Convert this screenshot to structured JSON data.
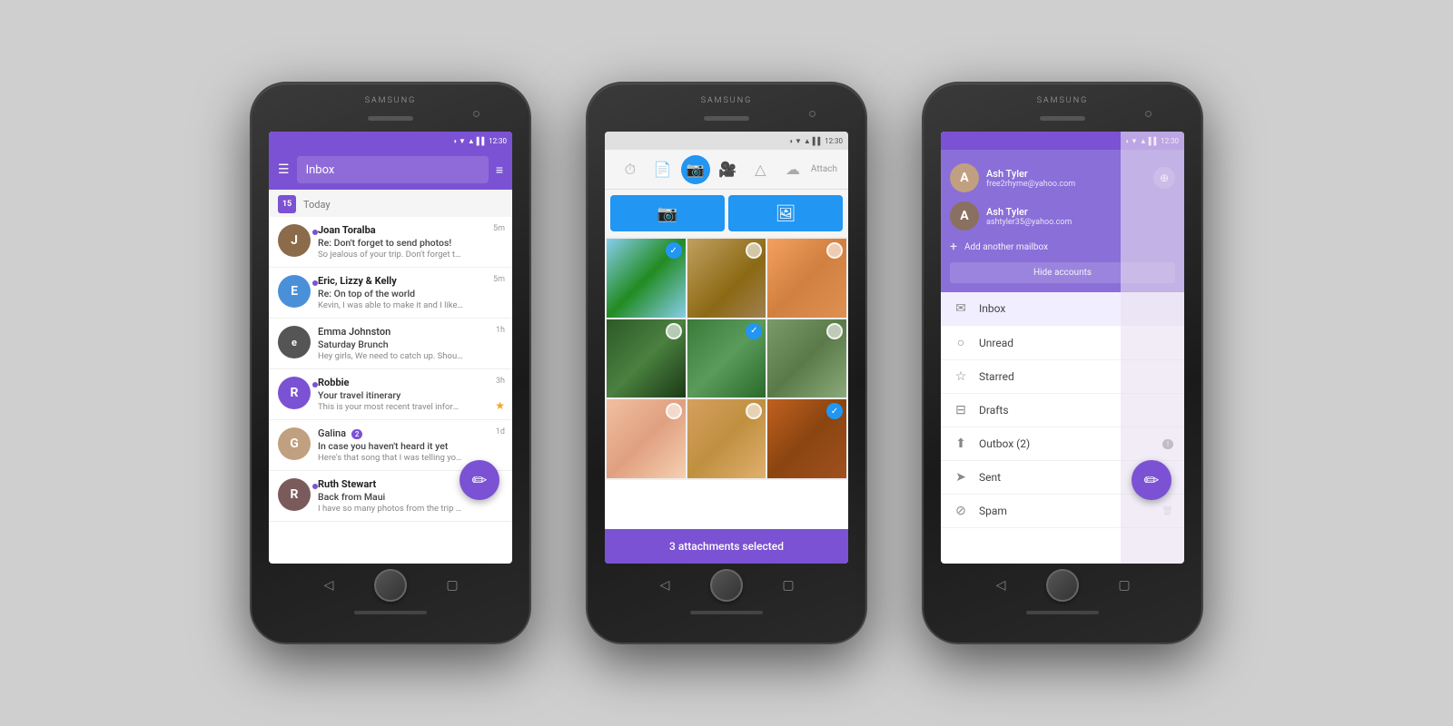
{
  "scene": {
    "background": "#d0cfd0"
  },
  "phone1": {
    "brand": "SAMSUNG",
    "status": "12:30",
    "appbar": {
      "title": "Inbox"
    },
    "date_header": {
      "day": "15",
      "label": "Today"
    },
    "emails": [
      {
        "sender": "Joan Toralba",
        "subject": "Re: Don't forget to send photos!",
        "preview": "So jealous of your trip. Don't forget to shar...",
        "time": "5m",
        "unread": true,
        "avatar_letter": "J",
        "avatar_class": "avatar-j"
      },
      {
        "sender": "Eric, Lizzy & Kelly",
        "subject": "Re: On top of the world",
        "preview": "Kevin, I was able to make it and I liked w...",
        "time": "5m",
        "unread": true,
        "avatar_letter": "E",
        "avatar_class": "avatar-e"
      },
      {
        "sender": "Emma Johnston",
        "subject": "Saturday Brunch",
        "preview": "Hey girls, We need to catch up. Should I...",
        "time": "1h",
        "unread": false,
        "avatar_letter": "E",
        "avatar_class": "avatar-e"
      },
      {
        "sender": "Robbie",
        "subject": "Your travel itinerary",
        "preview": "This is your most recent travel informat...",
        "time": "3h",
        "unread": true,
        "starred": true,
        "avatar_letter": "R",
        "avatar_class": "avatar-r"
      },
      {
        "sender": "Galina",
        "badge": "2",
        "subject": "In case you haven't heard it yet",
        "preview": "Here's that song that I was telling you ...",
        "time": "1d",
        "unread": false,
        "avatar_letter": "G",
        "avatar_class": "avatar-g"
      },
      {
        "sender": "Ruth Stewart",
        "subject": "Back from Maui",
        "preview": "I have so many photos from the trip th...",
        "time": "",
        "unread": true,
        "avatar_letter": "R",
        "avatar_class": "avatar-rs"
      }
    ]
  },
  "phone2": {
    "brand": "SAMSUNG",
    "status": "12:30",
    "attach_label": "Attach",
    "action_buttons": {
      "camera": "📷",
      "gallery": "🖼"
    },
    "footer_text": "3 attachments selected",
    "photos": [
      {
        "id": 1,
        "class": "p1",
        "selected": true
      },
      {
        "id": 2,
        "class": "p2",
        "selected": false
      },
      {
        "id": 3,
        "class": "p3",
        "selected": false
      },
      {
        "id": 4,
        "class": "p4",
        "selected": false
      },
      {
        "id": 5,
        "class": "p5",
        "selected": true
      },
      {
        "id": 6,
        "class": "p6",
        "selected": false
      },
      {
        "id": 7,
        "class": "p7",
        "selected": false
      },
      {
        "id": 8,
        "class": "p8",
        "selected": false
      },
      {
        "id": 9,
        "class": "p9",
        "selected": true
      }
    ]
  },
  "phone3": {
    "brand": "SAMSUNG",
    "status": "12:30",
    "accounts": [
      {
        "name": "Ash Tyler",
        "email": "free2rhyme@yahoo.com",
        "letter": "A"
      },
      {
        "name": "Ash Tyler",
        "email": "ashtyler35@yahoo.com",
        "letter": "A"
      }
    ],
    "add_mailbox": "Add another mailbox",
    "hide_accounts": "Hide accounts",
    "nav_items": [
      {
        "label": "Inbox",
        "icon": "✉",
        "active": true
      },
      {
        "label": "Unread",
        "icon": "○"
      },
      {
        "label": "Starred",
        "icon": "☆"
      },
      {
        "label": "Drafts",
        "icon": "⊟"
      },
      {
        "label": "Outbox (2)",
        "icon": "⬆",
        "badge": "!"
      },
      {
        "label": "Sent",
        "icon": "➤"
      },
      {
        "label": "Spam",
        "icon": "⊘"
      }
    ]
  }
}
